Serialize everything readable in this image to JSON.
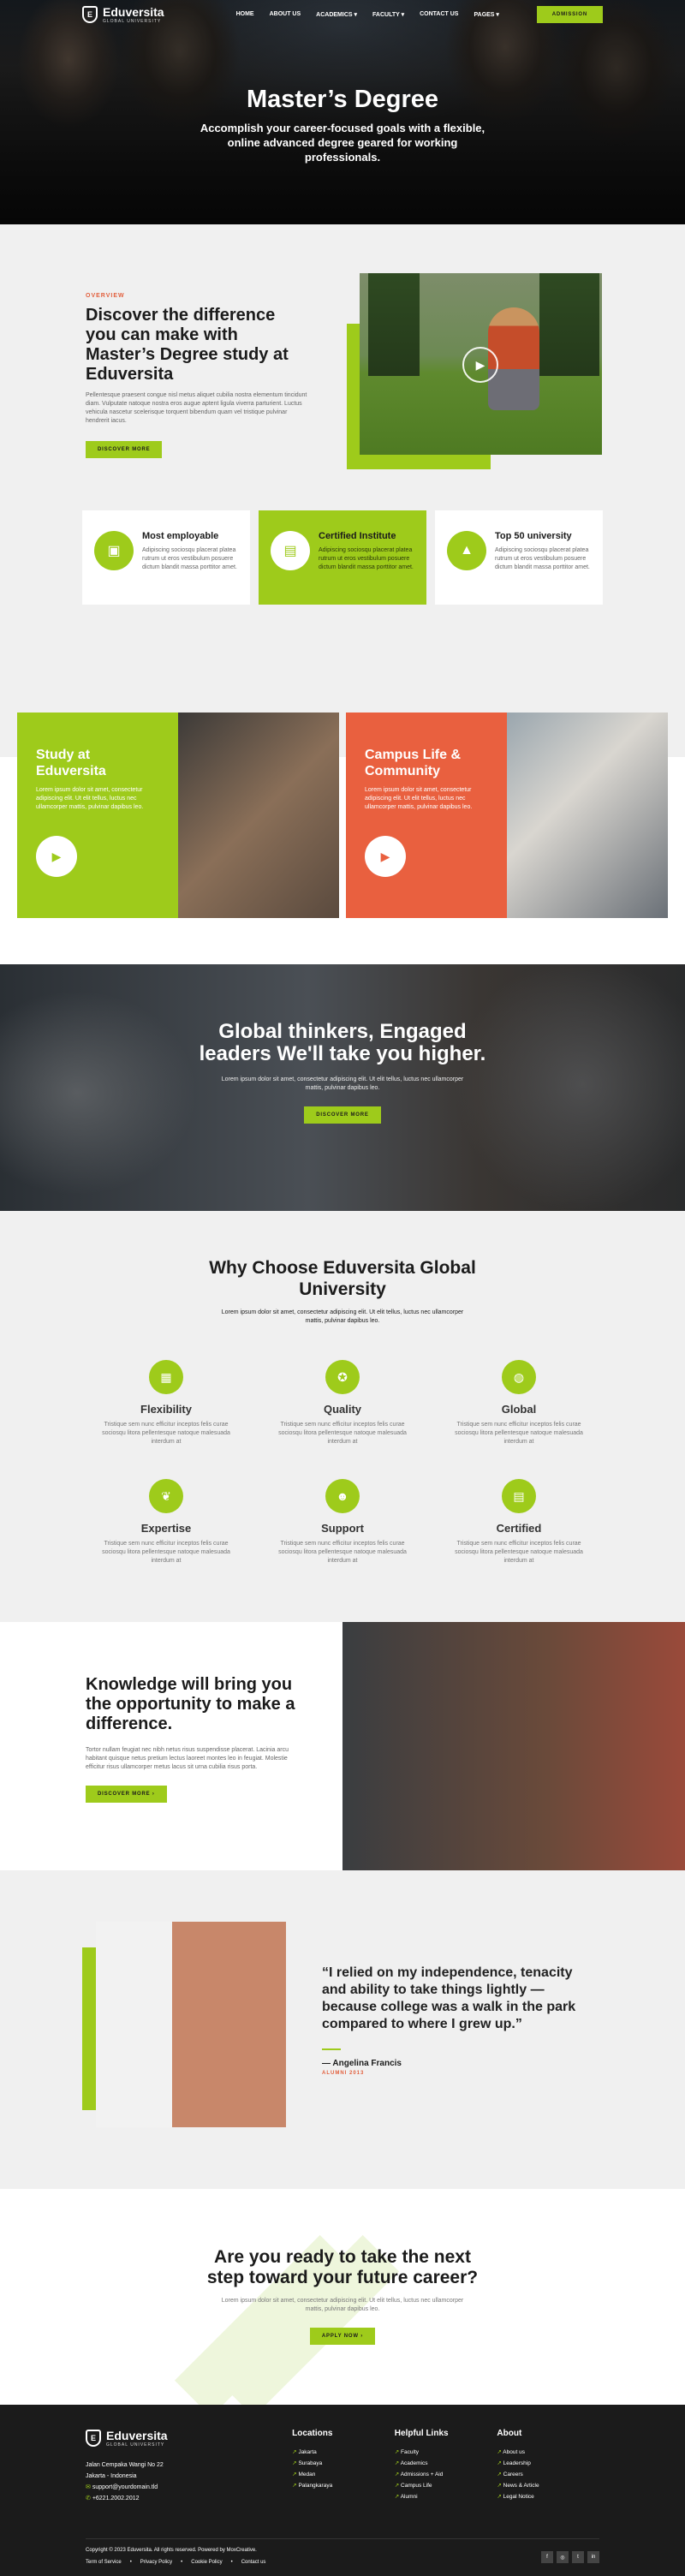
{
  "brand": {
    "name": "Eduversita",
    "tag": "GLOBAL UNIVERSITY"
  },
  "nav": {
    "items": [
      "HOME",
      "ABOUT US",
      "ACADEMICS ▾",
      "FACULTY ▾",
      "CONTACT US",
      "PAGES ▾"
    ],
    "cta": "ADMISSION"
  },
  "hero": {
    "title": "Master’s Degree",
    "subtitle": "Accomplish your career-focused goals with a flexible, online advanced degree geared for working professionals."
  },
  "overview": {
    "kicker": "OVERVIEW",
    "title": "Discover the difference you can make with Master’s Degree study at Eduversita",
    "body": "Pellentesque praesent congue nisl metus aliquet cubilia nostra elementum tincidunt diam. Vulputate natoque nostra eros augue aptent ligula viverra parturient. Luctus vehicula nascetur scelerisque torquent bibendum quam vel tristique pulvinar hendrerit iacus.",
    "button": "DISCOVER MORE"
  },
  "features": [
    {
      "title": "Most employable",
      "body": "Adipiscing sociosqu placerat platea rutrum ut eros vestibulum posuere dictum blandit massa porttitor amet."
    },
    {
      "title": "Certified Institute",
      "body": "Adipiscing sociosqu placerat platea rutrum ut eros vestibulum posuere dictum blandit massa porttitor amet."
    },
    {
      "title": "Top 50 university",
      "body": "Adipiscing sociosqu placerat platea rutrum ut eros vestibulum posuere dictum blandit massa porttitor amet."
    }
  ],
  "cards": [
    {
      "title": "Study at Eduversita",
      "body": "Lorem ipsum dolor sit amet, consectetur adipiscing elit. Ut elit tellus, luctus nec ullamcorper mattis, pulvinar dapibus leo.",
      "color": "#9ecb1b"
    },
    {
      "title": "Campus Life & Community",
      "body": "Lorem ipsum dolor sit amet, consectetur adipiscing elit. Ut elit tellus, luctus nec ullamcorper mattis, pulvinar dapibus leo.",
      "color": "#e9603f"
    }
  ],
  "thinkers": {
    "title": "Global thinkers, Engaged leaders We'll take you higher.",
    "body": "Lorem ipsum dolor sit amet, consectetur adipiscing elit. Ut elit tellus, luctus nec ullamcorper mattis, pulvinar dapibus leo.",
    "button": "DISCOVER MORE"
  },
  "why": {
    "title": "Why Choose Eduversita Global University",
    "lead": "Lorem ipsum dolor sit amet, consectetur adipiscing elit. Ut elit tellus, luctus nec ullamcorper mattis, pulvinar dapibus leo.",
    "items": [
      {
        "title": "Flexibility",
        "body": "Tristique sem nunc efficitur inceptos felis curae sociosqu litora pellentesque natoque malesuada interdum at"
      },
      {
        "title": "Quality",
        "body": "Tristique sem nunc efficitur inceptos felis curae sociosqu litora pellentesque natoque malesuada interdum at"
      },
      {
        "title": "Global",
        "body": "Tristique sem nunc efficitur inceptos felis curae sociosqu litora pellentesque natoque malesuada interdum at"
      },
      {
        "title": "Expertise",
        "body": "Tristique sem nunc efficitur inceptos felis curae sociosqu litora pellentesque natoque malesuada interdum at"
      },
      {
        "title": "Support",
        "body": "Tristique sem nunc efficitur inceptos felis curae sociosqu litora pellentesque natoque malesuada interdum at"
      },
      {
        "title": "Certified",
        "body": "Tristique sem nunc efficitur inceptos felis curae sociosqu litora pellentesque natoque malesuada interdum at"
      }
    ]
  },
  "knowledge": {
    "title": "Knowledge will bring you the opportunity to make a difference.",
    "body": "Tortor nullam feugiat nec nibh netus risus suspendisse placerat. Lacinia arcu habitant quisque netus pretium lectus laoreet montes leo in feugiat. Molestie efficitur risus ullamcorper metus lacus sit urna cubilia risus porta.",
    "button": "DISCOVER MORE ›"
  },
  "testimonial": {
    "quote": "“I relied on my independence, tenacity and ability to take things lightly — because college was a walk in the park compared to where I grew up.”",
    "name": "— Angelina Francis",
    "role": "ALUMNI 2013"
  },
  "cta": {
    "title": "Are you ready to take the next step toward your future career?",
    "body": "Lorem ipsum dolor sit amet, consectetur adipiscing elit. Ut elit tellus, luctus nec ullamcorper mattis, pulvinar dapibus leo.",
    "button": "APPLY NOW ›"
  },
  "footer": {
    "address": "Jalan Cempaka Wangi No 22",
    "city": "Jakarta - Indonesia",
    "email": "support@yourdomain.tld",
    "phone": "+6221.2002.2012",
    "columns": [
      {
        "title": "Locations",
        "items": [
          "Jakarta",
          "Surabaya",
          "Medan",
          "Palangkaraya"
        ]
      },
      {
        "title": "Helpful Links",
        "items": [
          "Faculty",
          "Academics",
          "Admissions + Aid",
          "Campus Life",
          "Alumni"
        ]
      },
      {
        "title": "About",
        "items": [
          "About us",
          "Leadership",
          "Careers",
          "News & Article",
          "Legal Notice"
        ]
      }
    ],
    "copyright": "Copyright © 2023 Eduversita. All rights reserved. Powered by MoxCreative.",
    "legal": [
      "Term of Service",
      "Privacy Policy",
      "Cookie Policy",
      "Contact us"
    ]
  },
  "colors": {
    "accent": "#9ecb1b",
    "coral": "#e9603f",
    "dark": "#1b1b1b"
  }
}
